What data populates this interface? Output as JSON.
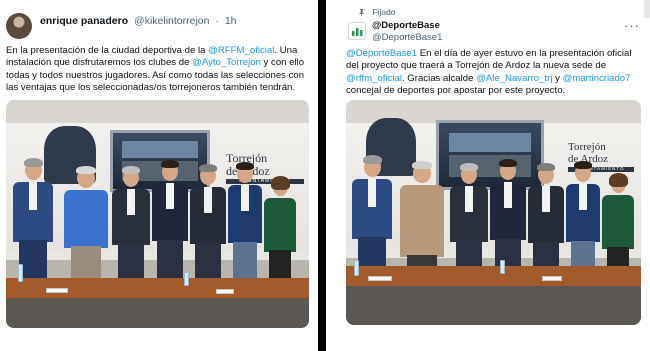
{
  "left_tweet": {
    "author_name": "enrique panadero",
    "author_handle": "@kikelintorrejon",
    "separator": "·",
    "time": "1h",
    "text_segments": [
      {
        "t": "En la presentación de la ciudad deportiva de la ",
        "m": false
      },
      {
        "t": "@RFFM_oficial",
        "m": true
      },
      {
        "t": ". Una instalación que disfrutaremos los clubes de ",
        "m": false
      },
      {
        "t": "@Ayto_Torrejon",
        "m": true
      },
      {
        "t": " y con ello todas y todos nuestros jugadores. Así  como todas las selecciones con las ventajas que los seleccionadas/os torrejoneros también tendrán.",
        "m": false
      }
    ],
    "photo": {
      "sign_title_line1": "Torrejón",
      "sign_title_line2": "de Ardoz",
      "sign_sub": "AYUNTAMIENTO"
    }
  },
  "right_tweet": {
    "pinned_label": "Fijado",
    "author_name": "@DeporteBase",
    "author_handle": "@DeporteBase1",
    "more_label": "···",
    "text_segments": [
      {
        "t": "@DeporteBase1",
        "m": true
      },
      {
        "t": " En el día de ayer  estuvo en la presentación oficial del proyecto que traerá a Torrejón de Ardoz la nueva sede de ",
        "m": false
      },
      {
        "t": "@rffm_oficial",
        "m": true
      },
      {
        "t": ". Gracias alcalde ",
        "m": false
      },
      {
        "t": "@Ale_Navarro_trj",
        "m": true
      },
      {
        "t": " y ",
        "m": false
      },
      {
        "t": "@martincriado7",
        "m": true
      },
      {
        "t": " concejal de deportes por apostar por este proyecto.",
        "m": false
      }
    ],
    "photo": {
      "sign_title_line1": "Torrejón",
      "sign_title_line2": "de Ardoz",
      "sign_sub": "AYUNTAMIENTO"
    }
  },
  "colors": {
    "mention": "#1d9bf0",
    "secondary_text": "#536471",
    "divider": "#000000"
  },
  "icons": [
    "pin-icon",
    "avatar-bars-icon",
    "more-options-icon"
  ]
}
